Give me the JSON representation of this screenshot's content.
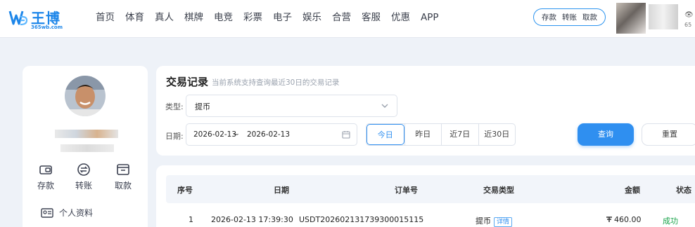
{
  "brand": {
    "name": "王博",
    "sub": "365wb.com"
  },
  "nav": [
    "首页",
    "体育",
    "真人",
    "棋牌",
    "电竞",
    "彩票",
    "电子",
    "娱乐",
    "合营",
    "客服",
    "优惠",
    "APP"
  ],
  "quick_actions": [
    "存款",
    "转账",
    "取款"
  ],
  "user_balance_prefix": "65",
  "sidebar": {
    "actions": [
      {
        "label": "存款",
        "icon": "deposit-icon"
      },
      {
        "label": "转账",
        "icon": "transfer-icon"
      },
      {
        "label": "取款",
        "icon": "withdraw-icon"
      }
    ],
    "profile_label": "个人资料"
  },
  "filter": {
    "title": "交易记录",
    "note": "当前系统支持查询最近30日的交易记录",
    "type_label": "类型:",
    "type_value": "提币",
    "date_label": "日期:",
    "date_from": "2026-02-13",
    "date_sep": "~",
    "date_to": "2026-02-13",
    "ranges": [
      "今日",
      "昨日",
      "近7日",
      "近30日"
    ],
    "active_range": "今日",
    "query_label": "查询",
    "reset_label": "重置"
  },
  "table": {
    "headers": [
      "序号",
      "日期",
      "订单号",
      "交易类型",
      "金额",
      "状态"
    ],
    "rows": [
      {
        "index": "1",
        "date": "2026-02-13 17:39:30",
        "order": "USDT20260213173930001511​5",
        "type": "提币",
        "detail": "详情",
        "amount": "460.00",
        "status": "成功"
      }
    ]
  },
  "colors": {
    "accent": "#2f8ff0",
    "success": "#1aa34a"
  }
}
